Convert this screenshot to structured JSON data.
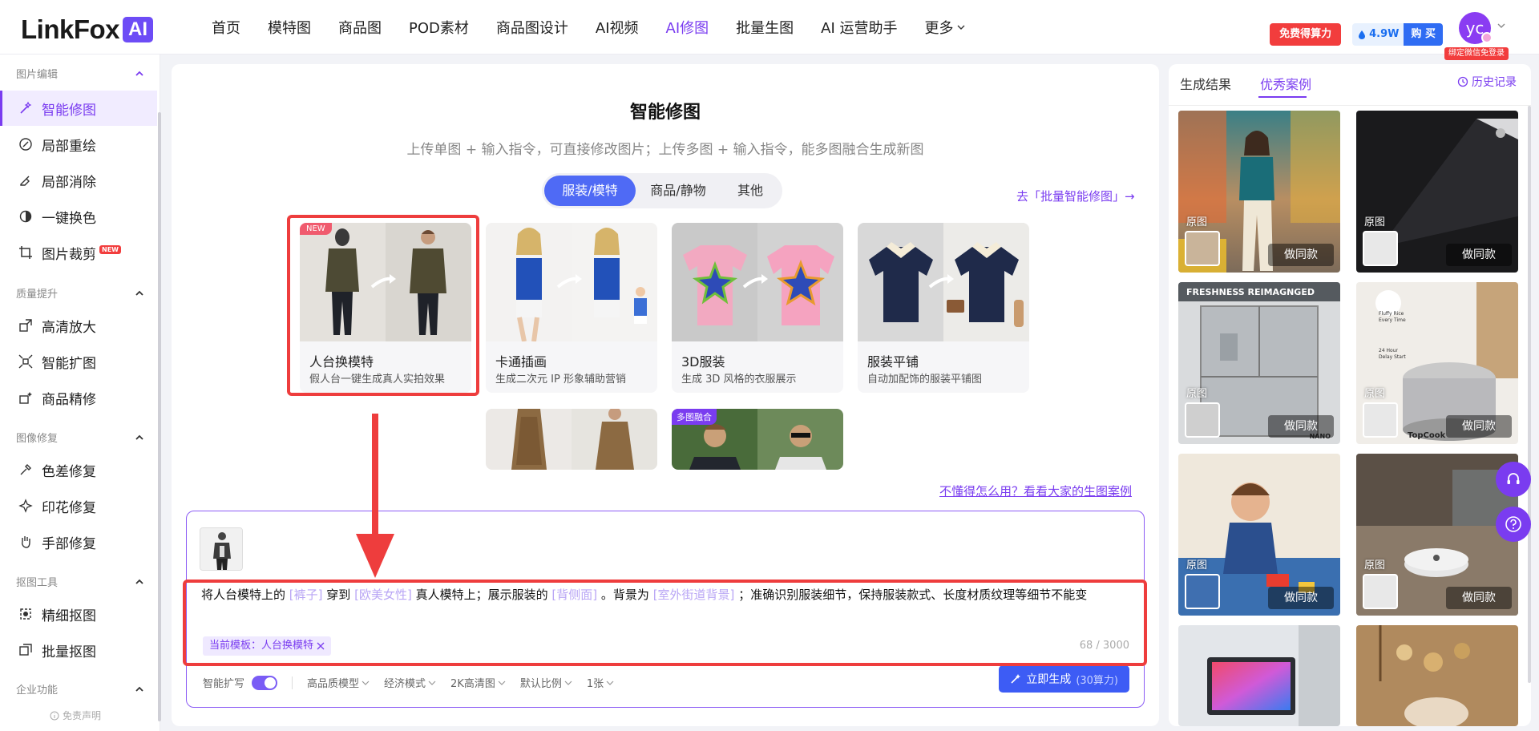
{
  "brand": {
    "logo_text": "LinkFox",
    "logo_badge": "AI"
  },
  "nav": {
    "items": [
      "首页",
      "模特图",
      "商品图",
      "POD素材",
      "商品图设计",
      "AI视频",
      "AI修图",
      "批量生图",
      "AI 运营助手"
    ],
    "more": "更多",
    "active": "AI修图"
  },
  "header_right": {
    "free_points": "免费得算力",
    "points_value": "4.9W",
    "buy": "购 买",
    "avatar_initials": "yc",
    "bind_tip": "绑定微信免登录"
  },
  "sidebar": {
    "groups": [
      {
        "title": "图片编辑",
        "items": [
          "智能修图",
          "局部重绘",
          "局部消除",
          "一键换色",
          "图片裁剪"
        ]
      },
      {
        "title": "质量提升",
        "items": [
          "高清放大",
          "智能扩图",
          "商品精修"
        ]
      },
      {
        "title": "图像修复",
        "items": [
          "色差修复",
          "印花修复",
          "手部修复"
        ]
      },
      {
        "title": "抠图工具",
        "items": [
          "精细抠图",
          "批量抠图"
        ]
      },
      {
        "title": "企业功能",
        "items": []
      }
    ],
    "active_item": "智能修图",
    "new_badge": "NEW",
    "footer": "免责声明"
  },
  "main": {
    "title": "智能修图",
    "subtitle": "上传单图 + 输入指令，可直接修改图片；上传多图 + 输入指令，能多图融合生成新图",
    "tabs": [
      "服装/模特",
      "商品/静物",
      "其他"
    ],
    "active_tab": "服装/模特",
    "batch_link": "去「批量智能修图」→",
    "templates": [
      {
        "name": "人台换模特",
        "desc": "假人台一键生成真人实拍效果",
        "badge": "NEW"
      },
      {
        "name": "卡通插画",
        "desc": "生成二次元 IP 形象辅助营销"
      },
      {
        "name": "3D服装",
        "desc": "生成 3D 风格的衣服展示"
      },
      {
        "name": "服装平铺",
        "desc": "自动加配饰的服装平铺图"
      },
      {
        "name": "",
        "desc": ""
      },
      {
        "name": "",
        "desc": "",
        "badge": "多图融合"
      }
    ],
    "help_link": "不懂得怎么用？看看大家的生图案例",
    "prompt": {
      "p1": "将人台模特上的",
      "s1": "[裤子]",
      "p2": "穿到",
      "s2": "[欧美女性]",
      "p3": "真人模特上；展示服装的",
      "s3": "[背侧面]",
      "p4": "。背景为",
      "s4": "[室外街道背景]",
      "p5": "；准确识别服装细节，保持服装款式、长度材质纹理等细节不能变",
      "template_tag": "当前模板：人台换模特",
      "counter": "68 / 3000"
    },
    "options": {
      "smart_expand": "智能扩写",
      "model": "高品质模型",
      "mode": "经济模式",
      "resolution": "2K高清图",
      "ratio": "默认比例",
      "count": "1张"
    },
    "generate": {
      "label": "立即生成",
      "cost": "(30算力)"
    }
  },
  "right_panel": {
    "tabs": [
      "生成结果",
      "优秀案例"
    ],
    "active_tab": "优秀案例",
    "history": "历史记录",
    "case_label": "原图",
    "case_action": "做同款",
    "case_texts": [
      "FRESHNESS REIMAGNGED",
      "NANO",
      "TopCook",
      "Fluffy Rice Every Time",
      "24 Hour Delay Start"
    ]
  },
  "colors": {
    "accent": "#7a3cf0",
    "primary_button": "#3d5cf5",
    "annotation_red": "#ee3d3d",
    "badge_red": "#f23d3d"
  }
}
